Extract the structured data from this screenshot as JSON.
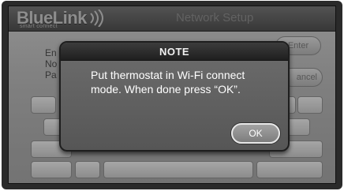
{
  "header": {
    "brand": "BlueLink",
    "tagline": "smart connect",
    "title": "Network Setup"
  },
  "background": {
    "field_labels": [
      "En",
      "No",
      "Pa"
    ],
    "enter_label": "Enter",
    "cancel_label": "ancel"
  },
  "dialog": {
    "title": "NOTE",
    "message": "Put thermostat in Wi-Fi connect mode. When done press “OK”.",
    "ok_label": "OK"
  }
}
